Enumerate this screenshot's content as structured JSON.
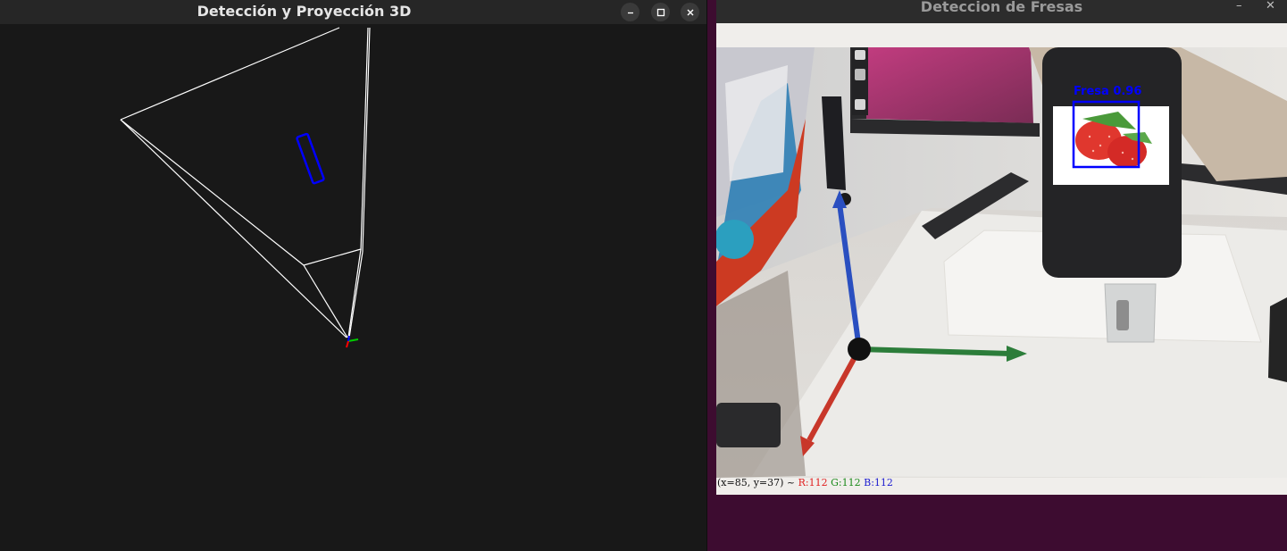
{
  "left_window": {
    "title": "Detección y Proyección 3D",
    "controls": {
      "minimize": "minimize-icon",
      "maximize": "maximize-icon",
      "close": "close-icon"
    },
    "colors": {
      "background": "#181818",
      "frustum_lines": "#ffffff",
      "detection_box": "#0000ff",
      "axis_x": "#ff0000",
      "axis_y": "#00cc00",
      "axis_z": "#0000ff"
    }
  },
  "right_window": {
    "title": "Deteccion de Fresas",
    "controls": {
      "minimize_glyph": "–",
      "close_glyph": "✕"
    },
    "detection": {
      "label": "Fresa",
      "confidence": "0.96",
      "box_color": "#0000ff"
    },
    "status": {
      "coords": "(x=85, y=37) ~",
      "r": "R:112",
      "g": "G:112",
      "b": "B:112"
    },
    "axes_colors": {
      "x": "#c8372a",
      "y": "#2c7d3a",
      "z": "#2a4fc0"
    }
  }
}
